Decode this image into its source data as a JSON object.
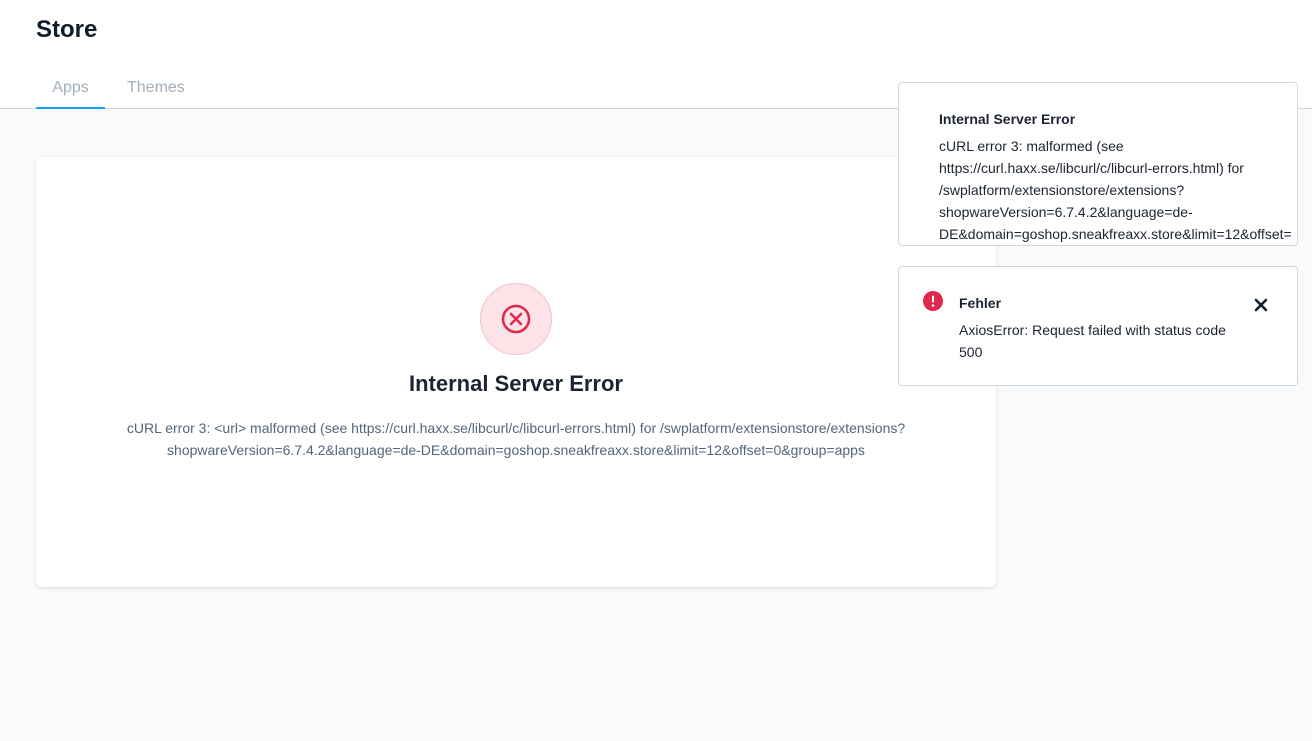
{
  "header": {
    "title": "Store",
    "tabs": [
      {
        "label": "Apps",
        "active": true
      },
      {
        "label": "Themes",
        "active": false
      }
    ]
  },
  "main": {
    "error": {
      "icon": "x-circle-icon",
      "title": "Internal Server Error",
      "message": "cURL error 3: <url> malformed (see https://curl.haxx.se/libcurl/c/libcurl-errors.html) for /swplatform/extensionstore/extensions?shopwareVersion=6.7.4.2&language=de-DE&domain=goshop.sneakfreaxx.store&limit=12&offset=0&group=apps"
    }
  },
  "notifications": [
    {
      "title": "Internal Server Error",
      "body": "cURL error 3: malformed (see https://curl.haxx.se/libcurl/c/libcurl-errors.html) for /swplatform/extensionstore/extensions?\nshopwareVersion=6.7.4.2&language=de-\nDE&domain=goshop.sneakfreaxx.store&limit=12&offset="
    },
    {
      "icon": "exclamation-circle-icon",
      "title": "Fehler",
      "body": "AxiosError: Request failed with status code 500",
      "close_icon": "close-icon"
    }
  ],
  "colors": {
    "accent": "#189eff",
    "error": "#de294c",
    "error_bg": "#fbe3e8"
  }
}
